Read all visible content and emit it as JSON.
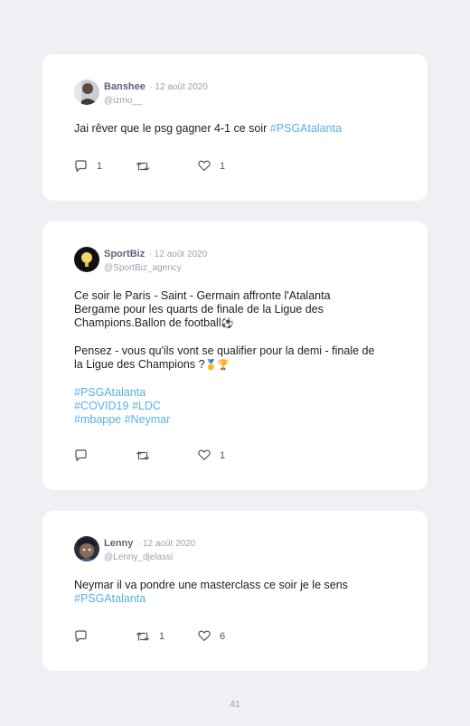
{
  "posts": [
    {
      "author": "Banshee",
      "date": "· 12 août 2020",
      "handle": "@izmo__",
      "text": "Jai rêver que le psg gagner 4-1 ce soir ",
      "hashtag": "#PSGAtalanta",
      "replies": "1",
      "retweets": "",
      "likes": "1"
    },
    {
      "author": "SportBiz",
      "date": "· 12 août 2020",
      "handle": "@SportBiz_agency",
      "line1": "Ce soir le Paris - Saint - Germain affronte l'Atalanta",
      "line2": "Bergame pour les quarts de finale de la Ligue des",
      "line3": "Champions.Ballon de football",
      "line4": "Pensez - vous qu'ils vont se qualifier pour la demi - finale de",
      "line5": "la Ligue des Champions ?",
      "emoji_ball": "⚽",
      "emoji_medal": "🥇",
      "emoji_trophy": "🏆",
      "tag1": "#PSGAtalanta",
      "tag2": "#COVID19",
      "tag3": "#LDC",
      "tag4": "#mbappe",
      "tag5": "#Neymar",
      "replies": "",
      "retweets": "",
      "likes": "1"
    },
    {
      "author": "Lenny",
      "date": "· 12 août 2020",
      "handle": "@Lenny_djelassi",
      "line1": "Neymar il va pondre une masterclass ce soir je le sens",
      "hashtag": "#PSGAtalanta",
      "replies": "",
      "retweets": "1",
      "likes": "6"
    }
  ],
  "page_number": "41",
  "colors": {
    "hashtag": "#5ab0e0",
    "background": "#eef0f3",
    "card": "#ffffff"
  }
}
